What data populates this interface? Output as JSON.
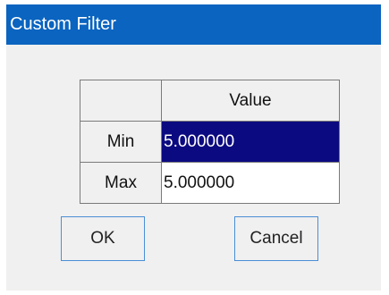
{
  "window": {
    "title": "Custom Filter"
  },
  "grid": {
    "column_header": "Value",
    "rows": [
      {
        "label": "Min",
        "value": "5.000000",
        "selected": true
      },
      {
        "label": "Max",
        "value": "5.000000",
        "selected": false
      }
    ]
  },
  "buttons": {
    "ok_label": "OK",
    "cancel_label": "Cancel"
  },
  "colors": {
    "titlebar": "#0a64c0",
    "selection": "#0b0a80",
    "dialog_background": "#f0f0f0",
    "button_border": "#4a8fd6"
  }
}
